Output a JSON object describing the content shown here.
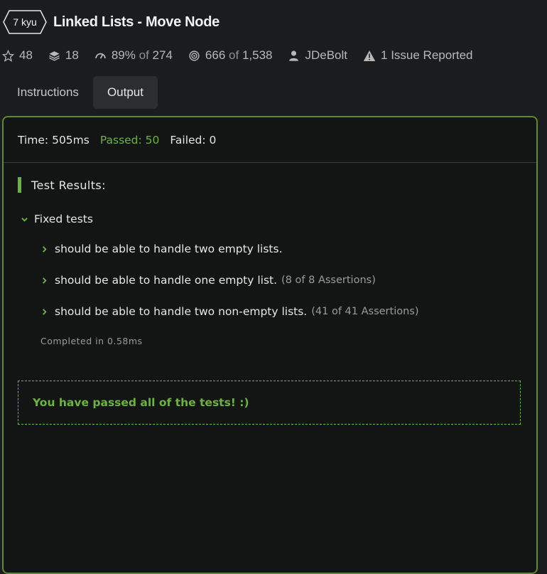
{
  "kata": {
    "rank": "7 kyu",
    "title": "Linked Lists - Move Node"
  },
  "stats": {
    "stars": "48",
    "collections": "18",
    "satisfaction": "89%",
    "satisfaction_of": "of",
    "satisfaction_votes": "274",
    "completions": "666",
    "completions_of": "of",
    "completions_total": "1,538",
    "author": "JDeBolt",
    "issues": "1 Issue Reported"
  },
  "tabs": [
    {
      "label": "Instructions",
      "active": false
    },
    {
      "label": "Output",
      "active": true
    }
  ],
  "summary": {
    "time": "Time: 505ms",
    "passed": "Passed: 50",
    "failed": "Failed: 0"
  },
  "results": {
    "title": "Test Results:",
    "group": "Fixed tests",
    "tests": [
      {
        "label": "should be able to handle two empty lists.",
        "assertions": ""
      },
      {
        "label": "should be able to handle one empty list.",
        "assertions": "(8 of 8 Assertions)"
      },
      {
        "label": "should be able to handle two non-empty lists.",
        "assertions": "(41 of 41 Assertions)"
      }
    ],
    "completed": "Completed in 0.58ms"
  },
  "pass_message": "You have passed all of the tests! :)",
  "colors": {
    "background": "#1b1c1e",
    "panel": "#131515",
    "accent_green": "#6cb33e",
    "panel_border": "#5d8a2b"
  },
  "icons": [
    "star-icon",
    "layers-icon",
    "gauge-icon",
    "target-icon",
    "user-icon",
    "warning-icon",
    "chevron-down-icon",
    "chevron-right-icon"
  ]
}
